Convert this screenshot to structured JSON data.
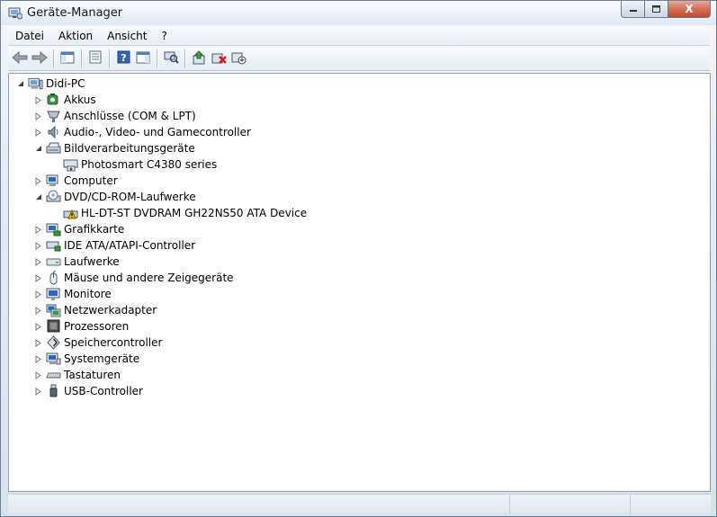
{
  "window": {
    "title": "Geräte-Manager",
    "caption_buttons": {
      "minimize": "▁",
      "maximize": "☐",
      "close": "X"
    }
  },
  "menu": {
    "items": [
      {
        "label": "Datei"
      },
      {
        "label": "Aktion"
      },
      {
        "label": "Ansicht"
      },
      {
        "label": "?"
      }
    ]
  },
  "toolbar": {
    "buttons": [
      {
        "icon": "back-arrow-icon"
      },
      {
        "icon": "forward-arrow-icon"
      },
      {
        "icon": "show-hide-console-tree-icon"
      },
      {
        "icon": "properties-icon"
      },
      {
        "icon": "help-icon"
      },
      {
        "icon": "show-action-pane-icon"
      },
      {
        "icon": "scan-hardware-icon"
      },
      {
        "icon": "update-driver-icon"
      },
      {
        "icon": "uninstall-icon"
      },
      {
        "icon": "disable-device-icon"
      }
    ]
  },
  "tree": {
    "root": {
      "label": "Didi-PC",
      "icon": "computer-icon"
    },
    "categories": [
      {
        "label": "Akkus",
        "icon": "battery-icon",
        "expanded": false
      },
      {
        "label": "Anschlüsse (COM & LPT)",
        "icon": "port-icon",
        "expanded": false
      },
      {
        "label": "Audio-, Video- und Gamecontroller",
        "icon": "speaker-icon",
        "expanded": false
      },
      {
        "label": "Bildverarbeitungsgeräte",
        "icon": "scanner-icon",
        "expanded": true,
        "children": [
          {
            "label": "Photosmart C4380 series",
            "icon": "scanner-device-icon"
          }
        ]
      },
      {
        "label": "Computer",
        "icon": "computer-icon",
        "expanded": false
      },
      {
        "label": "DVD/CD-ROM-Laufwerke",
        "icon": "dvd-drive-icon",
        "expanded": true,
        "children": [
          {
            "label": "HL-DT-ST DVDRAM GH22NS50 ATA Device",
            "icon": "dvd-warning-icon"
          }
        ]
      },
      {
        "label": "Grafikkarte",
        "icon": "display-adapter-icon",
        "expanded": false
      },
      {
        "label": "IDE ATA/ATAPI-Controller",
        "icon": "ide-controller-icon",
        "expanded": false
      },
      {
        "label": "Laufwerke",
        "icon": "disk-drive-icon",
        "expanded": false
      },
      {
        "label": "Mäuse und andere Zeigegeräte",
        "icon": "mouse-icon",
        "expanded": false
      },
      {
        "label": "Monitore",
        "icon": "monitor-icon",
        "expanded": false
      },
      {
        "label": "Netzwerkadapter",
        "icon": "network-adapter-icon",
        "expanded": false
      },
      {
        "label": "Prozessoren",
        "icon": "processor-icon",
        "expanded": false
      },
      {
        "label": "Speichercontroller",
        "icon": "storage-controller-icon",
        "expanded": false
      },
      {
        "label": "Systemgeräte",
        "icon": "system-device-icon",
        "expanded": false
      },
      {
        "label": "Tastaturen",
        "icon": "keyboard-icon",
        "expanded": false
      },
      {
        "label": "USB-Controller",
        "icon": "usb-icon",
        "expanded": false
      }
    ]
  },
  "colors": {
    "accent": "#1c5fb0",
    "warning": "#f2c200",
    "window_frame": "#6d7f97"
  }
}
